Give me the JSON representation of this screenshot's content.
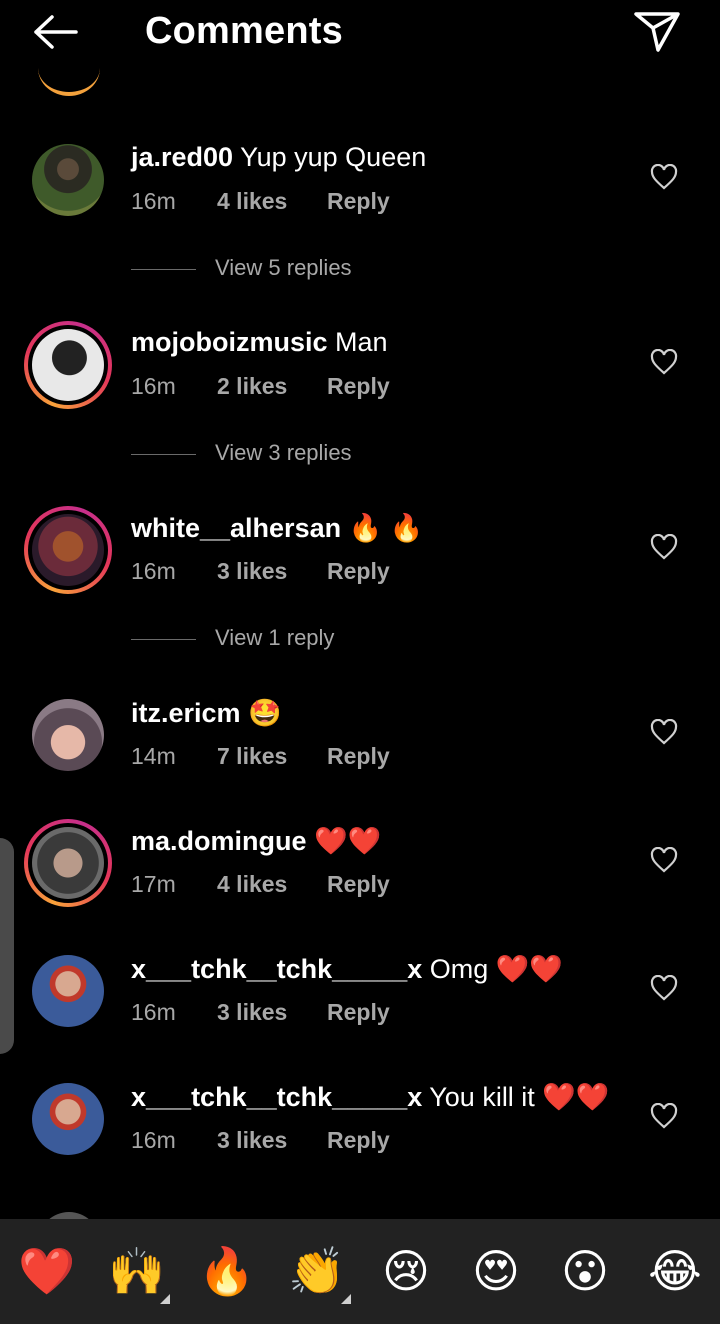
{
  "header": {
    "title": "Comments"
  },
  "comments": [
    {
      "username": "ja.red00",
      "text": "Yup yup Queen",
      "time": "16m",
      "likes": "4 likes",
      "reply": "Reply",
      "view_replies": "View 5 replies"
    },
    {
      "username": "mojoboizmusic",
      "text": "Man",
      "time": "16m",
      "likes": "2 likes",
      "reply": "Reply",
      "view_replies": "View 3 replies"
    },
    {
      "username": "white__alhersan",
      "text": "🔥 🔥",
      "time": "16m",
      "likes": "3 likes",
      "reply": "Reply",
      "view_replies": "View 1 reply"
    },
    {
      "username": "itz.ericm",
      "text": "🤩",
      "time": "14m",
      "likes": "7 likes",
      "reply": "Reply"
    },
    {
      "username": "ma.domingue",
      "text": "❤️❤️",
      "time": "17m",
      "likes": "4 likes",
      "reply": "Reply"
    },
    {
      "username": "x___tchk__tchk_____x",
      "text": "Omg ❤️❤️",
      "time": "16m",
      "likes": "3 likes",
      "reply": "Reply"
    },
    {
      "username": "x___tchk__tchk_____x",
      "text": "You kill it ❤️❤️",
      "time": "16m",
      "likes": "3 likes",
      "reply": "Reply"
    }
  ],
  "quick_reactions": [
    "❤️",
    "🙌",
    "🔥",
    "👏",
    "😢",
    "😍",
    "😮",
    "😂"
  ],
  "colors": {
    "background": "#000000",
    "meta_text": "#a8a8a8",
    "emoji_bar": "#222222",
    "ring_start": "#f9a23a",
    "ring_end": "#c62f8c"
  }
}
